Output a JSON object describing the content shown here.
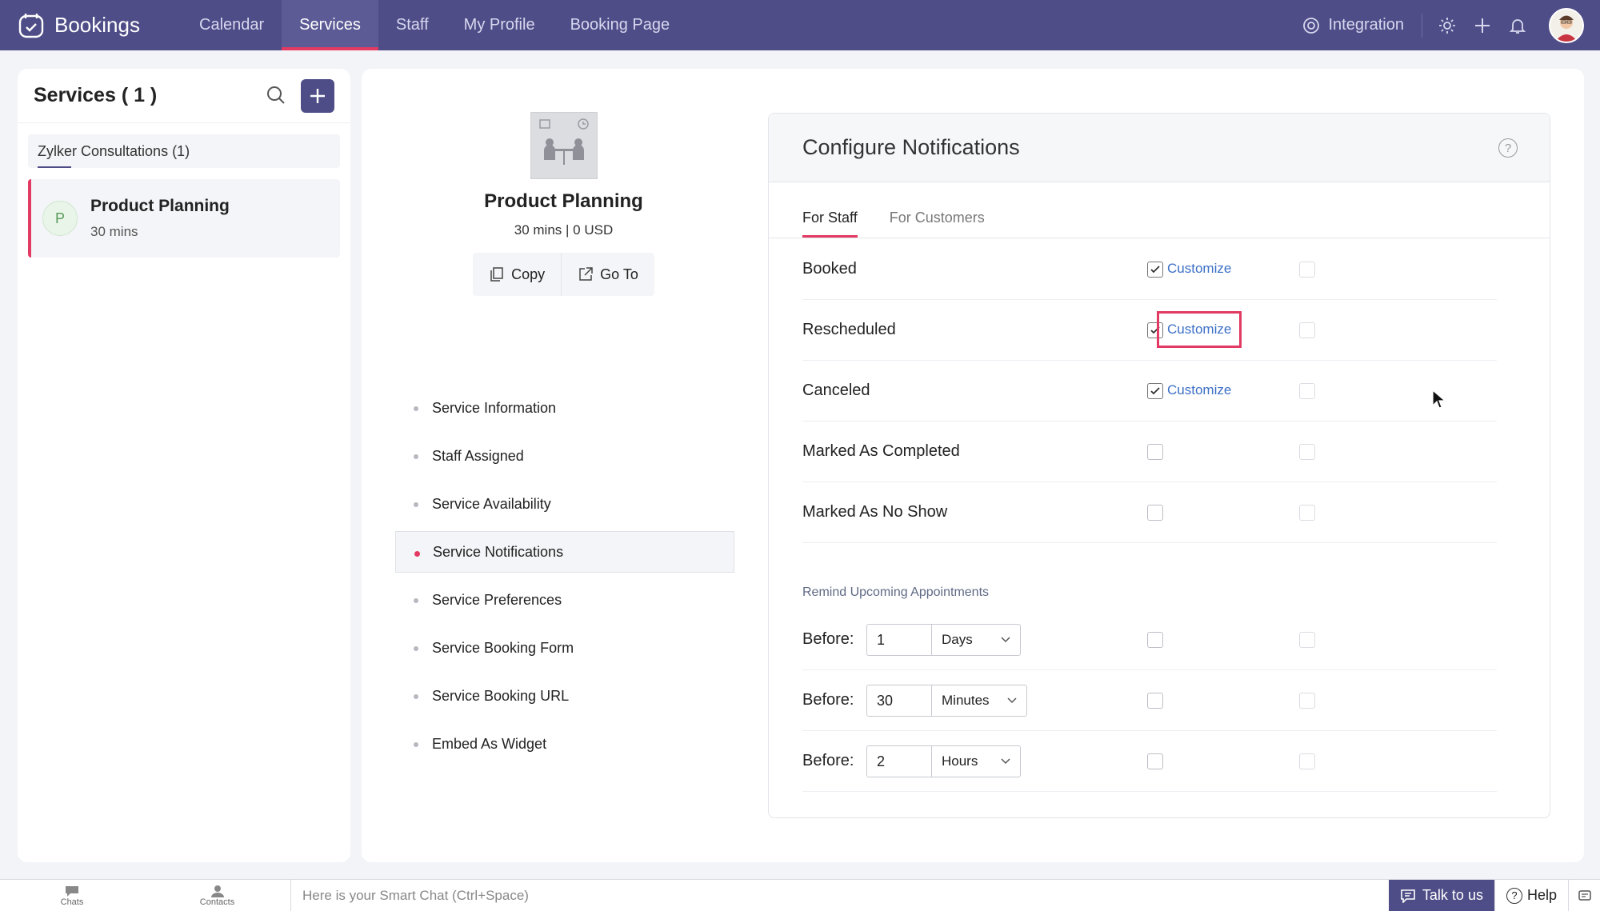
{
  "app": {
    "name": "Bookings"
  },
  "nav": {
    "items": [
      {
        "label": "Calendar",
        "active": false
      },
      {
        "label": "Services",
        "active": true
      },
      {
        "label": "Staff",
        "active": false
      },
      {
        "label": "My Profile",
        "active": false
      },
      {
        "label": "Booking Page",
        "active": false
      }
    ],
    "integration_label": "Integration"
  },
  "sidebar": {
    "title": "Services ( 1 )",
    "group_label": "Zylker Consultations (1)",
    "service": {
      "initial": "P",
      "name": "Product Planning",
      "duration": "30 mins"
    }
  },
  "service_detail": {
    "title": "Product Planning",
    "meta": "30 mins | 0 USD",
    "copy_label": "Copy",
    "goto_label": "Go To",
    "menu": [
      {
        "label": "Service Information",
        "active": false
      },
      {
        "label": "Staff Assigned",
        "active": false
      },
      {
        "label": "Service Availability",
        "active": false
      },
      {
        "label": "Service Notifications",
        "active": true
      },
      {
        "label": "Service Preferences",
        "active": false
      },
      {
        "label": "Service Booking Form",
        "active": false
      },
      {
        "label": "Service Booking URL",
        "active": false
      },
      {
        "label": "Embed As Widget",
        "active": false
      }
    ]
  },
  "notifications": {
    "title": "Configure Notifications",
    "help": "?",
    "tabs": [
      {
        "label": "For Staff",
        "active": true
      },
      {
        "label": "For Customers",
        "active": false
      }
    ],
    "customize_label": "Customize",
    "rows": [
      {
        "label": "Booked",
        "email": true,
        "customize": true
      },
      {
        "label": "Rescheduled",
        "email": true,
        "customize": true
      },
      {
        "label": "Canceled",
        "email": true,
        "customize": true
      },
      {
        "label": "Marked As Completed",
        "email": false,
        "customize": false
      },
      {
        "label": "Marked As No Show",
        "email": false,
        "customize": false
      }
    ],
    "remind_heading": "Remind Upcoming Appointments",
    "before_label": "Before:",
    "reminders": [
      {
        "value": "1",
        "unit": "Days"
      },
      {
        "value": "30",
        "unit": "Minutes"
      },
      {
        "value": "2",
        "unit": "Hours"
      }
    ]
  },
  "bottom": {
    "chats": "Chats",
    "contacts": "Contacts",
    "smart_chat_placeholder": "Here is your Smart Chat (Ctrl+Space)",
    "talk_label": "Talk to us",
    "help_label": "Help"
  },
  "colors": {
    "brand": "#4e4d87",
    "accent": "#e23a63",
    "link": "#3b6fc6"
  }
}
